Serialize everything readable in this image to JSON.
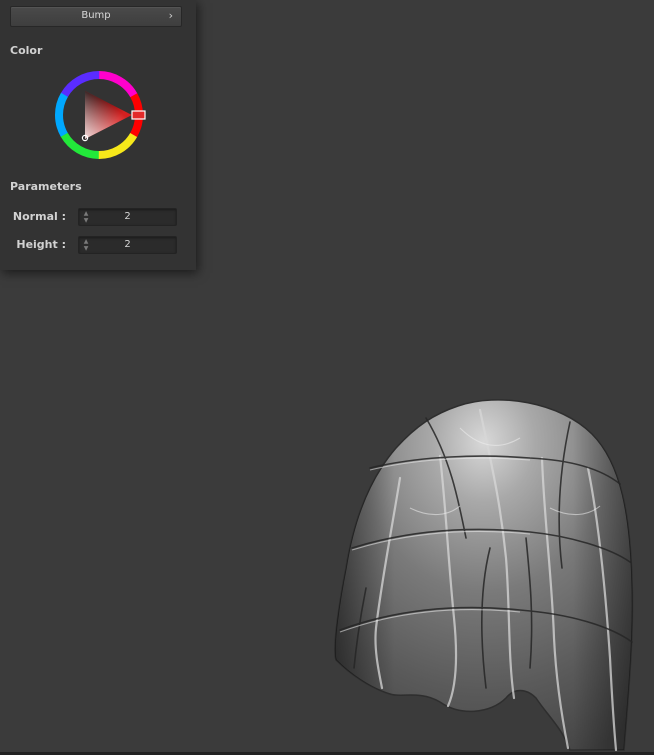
{
  "material_panel": {
    "dropdown_value": "Bump",
    "chevron": "›",
    "color_title": "Color",
    "selected_color": "#d42020",
    "parameters_title": "Parameters",
    "params": [
      {
        "label": "Normal :",
        "value": "2"
      },
      {
        "label": "Height :",
        "value": "2"
      }
    ]
  },
  "icons": {
    "spin_arrows": "spin-arrows-icon"
  },
  "colors": {
    "viewport_bg": "#3b3b3b",
    "panel_bg": "#333333",
    "field_bg": "#2b2b2b"
  }
}
